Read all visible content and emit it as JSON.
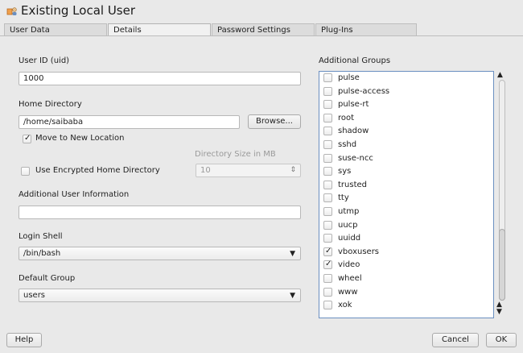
{
  "window": {
    "title": "Existing Local User",
    "icon": "user-settings-icon"
  },
  "tabs": [
    {
      "label": "User Data",
      "active": false
    },
    {
      "label": "Details",
      "active": true
    },
    {
      "label": "Password Settings",
      "active": false
    },
    {
      "label": "Plug-Ins",
      "active": false
    }
  ],
  "details": {
    "uid_label": "User ID (uid)",
    "uid_value": "1000",
    "home_label": "Home Directory",
    "home_value": "/home/saibaba",
    "browse_label": "Browse...",
    "move_label": "Move to New Location",
    "move_checked": true,
    "dir_size_label": "Directory Size in MB",
    "dir_size_value": "10",
    "encrypted_label": "Use Encrypted Home Directory",
    "encrypted_checked": false,
    "additional_info_label": "Additional User Information",
    "additional_info_value": "",
    "login_shell_label": "Login Shell",
    "login_shell_value": "/bin/bash",
    "default_group_label": "Default Group",
    "default_group_value": "users"
  },
  "groups": {
    "label": "Additional Groups",
    "items": [
      {
        "name": "pulse",
        "checked": false
      },
      {
        "name": "pulse-access",
        "checked": false
      },
      {
        "name": "pulse-rt",
        "checked": false
      },
      {
        "name": "root",
        "checked": false
      },
      {
        "name": "shadow",
        "checked": false
      },
      {
        "name": "sshd",
        "checked": false
      },
      {
        "name": "suse-ncc",
        "checked": false
      },
      {
        "name": "sys",
        "checked": false
      },
      {
        "name": "trusted",
        "checked": false
      },
      {
        "name": "tty",
        "checked": false
      },
      {
        "name": "utmp",
        "checked": false
      },
      {
        "name": "uucp",
        "checked": false
      },
      {
        "name": "uuidd",
        "checked": false
      },
      {
        "name": "vboxusers",
        "checked": true
      },
      {
        "name": "video",
        "checked": true
      },
      {
        "name": "wheel",
        "checked": false
      },
      {
        "name": "www",
        "checked": false
      },
      {
        "name": "xok",
        "checked": false
      }
    ]
  },
  "footer": {
    "help_label": "Help",
    "cancel_label": "Cancel",
    "ok_label": "OK"
  },
  "colors": {
    "background": "#e9e9e9",
    "list_border": "#6a8fc0",
    "field_border": "#b8b8b8"
  }
}
